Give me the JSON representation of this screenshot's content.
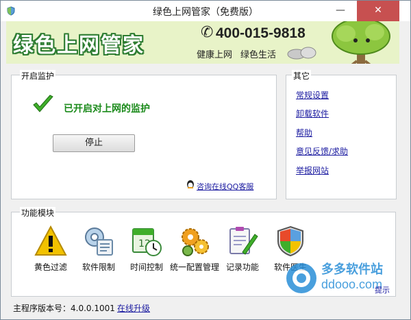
{
  "window": {
    "title": "绿色上网管家（免费版）",
    "minimize_glyph": "—",
    "close_glyph": "✕"
  },
  "banner": {
    "logo_text": "绿色上网管家",
    "phone": "400-015-9818",
    "slogan_1": "健康上网",
    "slogan_2": "绿色生活"
  },
  "monitor": {
    "group_label": "开启监护",
    "status_text": "已开启对上网的监护",
    "stop_button": "停止",
    "qq_support_link": "咨询在线QQ客服"
  },
  "other": {
    "group_label": "其它",
    "links": [
      "常规设置",
      "卸载软件",
      "帮助",
      "意见反馈/求助",
      "举报网站"
    ]
  },
  "functions": {
    "group_label": "功能模块",
    "items": [
      {
        "label": "黄色过滤",
        "icon": "warning-icon"
      },
      {
        "label": "软件限制",
        "icon": "software-gear-icon"
      },
      {
        "label": "时间控制",
        "icon": "calendar-clock-icon"
      },
      {
        "label": "统一配置管理",
        "icon": "gears-icon"
      },
      {
        "label": "记录功能",
        "icon": "clipboard-pen-icon"
      },
      {
        "label": "软件医生",
        "icon": "shield-icon"
      }
    ],
    "hint": "提示"
  },
  "statusbar": {
    "version_text": "主程序版本号：4.0.0.1001",
    "update_link": "在线升级"
  },
  "watermark": {
    "line_1": "多多软件站",
    "line_2": "ddooo.com"
  },
  "colors": {
    "accent_green": "#1a8a1a",
    "link_blue": "#1a1aa0",
    "banner_bg": "#e8f3c8",
    "close_red": "#c75050"
  }
}
